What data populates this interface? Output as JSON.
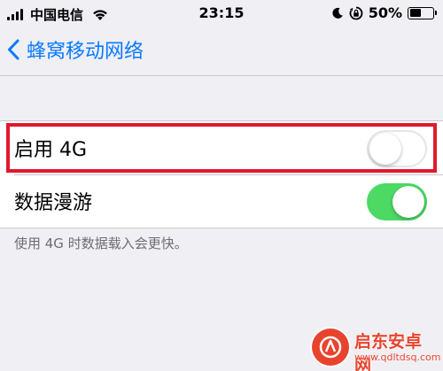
{
  "status_bar": {
    "carrier": "中国电信",
    "time": "23:15",
    "battery_percent": "50%",
    "battery_level": 0.5
  },
  "nav": {
    "back_label": "蜂窝移动网络"
  },
  "settings": {
    "rows": [
      {
        "label": "启用 4G",
        "toggle_on": false
      },
      {
        "label": "数据漫游",
        "toggle_on": true
      }
    ],
    "footnote": "使用 4G 时数据载入会更快。"
  },
  "colors": {
    "accent": "#0a7aff",
    "toggle_on": "#4cd964",
    "highlight": "#e0192c",
    "background": "#efeff4"
  },
  "watermark": {
    "name": "启东安卓网",
    "url": "www.qdltdsq.com"
  }
}
